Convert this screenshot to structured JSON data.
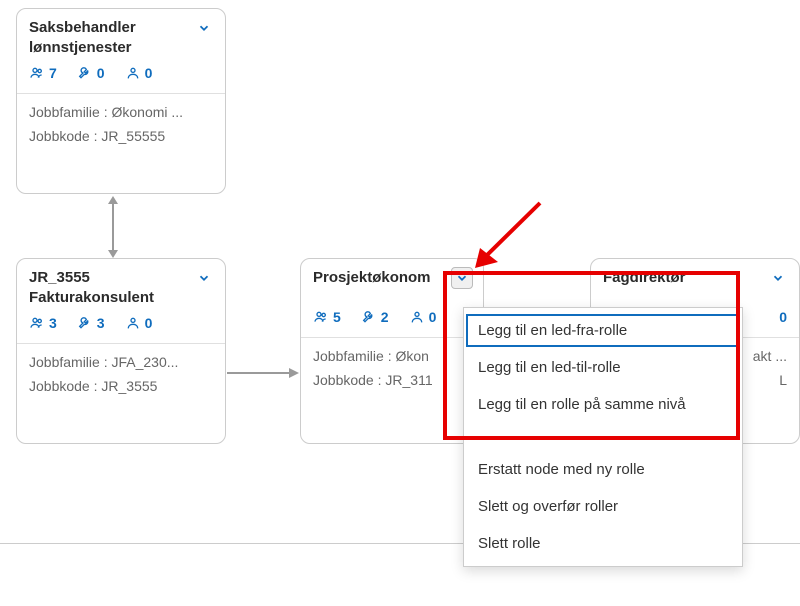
{
  "cards": {
    "saksbehandler": {
      "title1": "Saksbehandler",
      "title2": "lønnstjenester",
      "group": "7",
      "wrench": "0",
      "person": "0",
      "jobbfamilie": "Jobbfamilie : Økonomi ...",
      "jobbkode": "Jobbkode : JR_55555"
    },
    "fakturakonsulent": {
      "title1": "JR_3555",
      "title2": "Fakturakonsulent",
      "group": "3",
      "wrench": "3",
      "person": "0",
      "jobbfamilie": "Jobbfamilie : JFA_230...",
      "jobbkode": "Jobbkode : JR_3555"
    },
    "prosjektokonom": {
      "title1": "Prosjektøkonom",
      "group": "5",
      "wrench": "2",
      "person": "0",
      "jobbfamilie": "Jobbfamilie : Økon",
      "jobbkode": "Jobbkode : JR_311"
    },
    "fagdirektor": {
      "title1": "Fagdirektør",
      "person_suffix": "0",
      "jobbfamilie_suffix": "akt ...",
      "jobbkode_suffix": "L"
    }
  },
  "menu": {
    "led_fra": "Legg til en led-fra-rolle",
    "led_til": "Legg til en led-til-rolle",
    "samme_niva": "Legg til en rolle på samme nivå",
    "sep": "----------------------",
    "erstatt": "Erstatt node med ny rolle",
    "slett_overfor": "Slett og overfør roller",
    "slett": "Slett rolle"
  }
}
